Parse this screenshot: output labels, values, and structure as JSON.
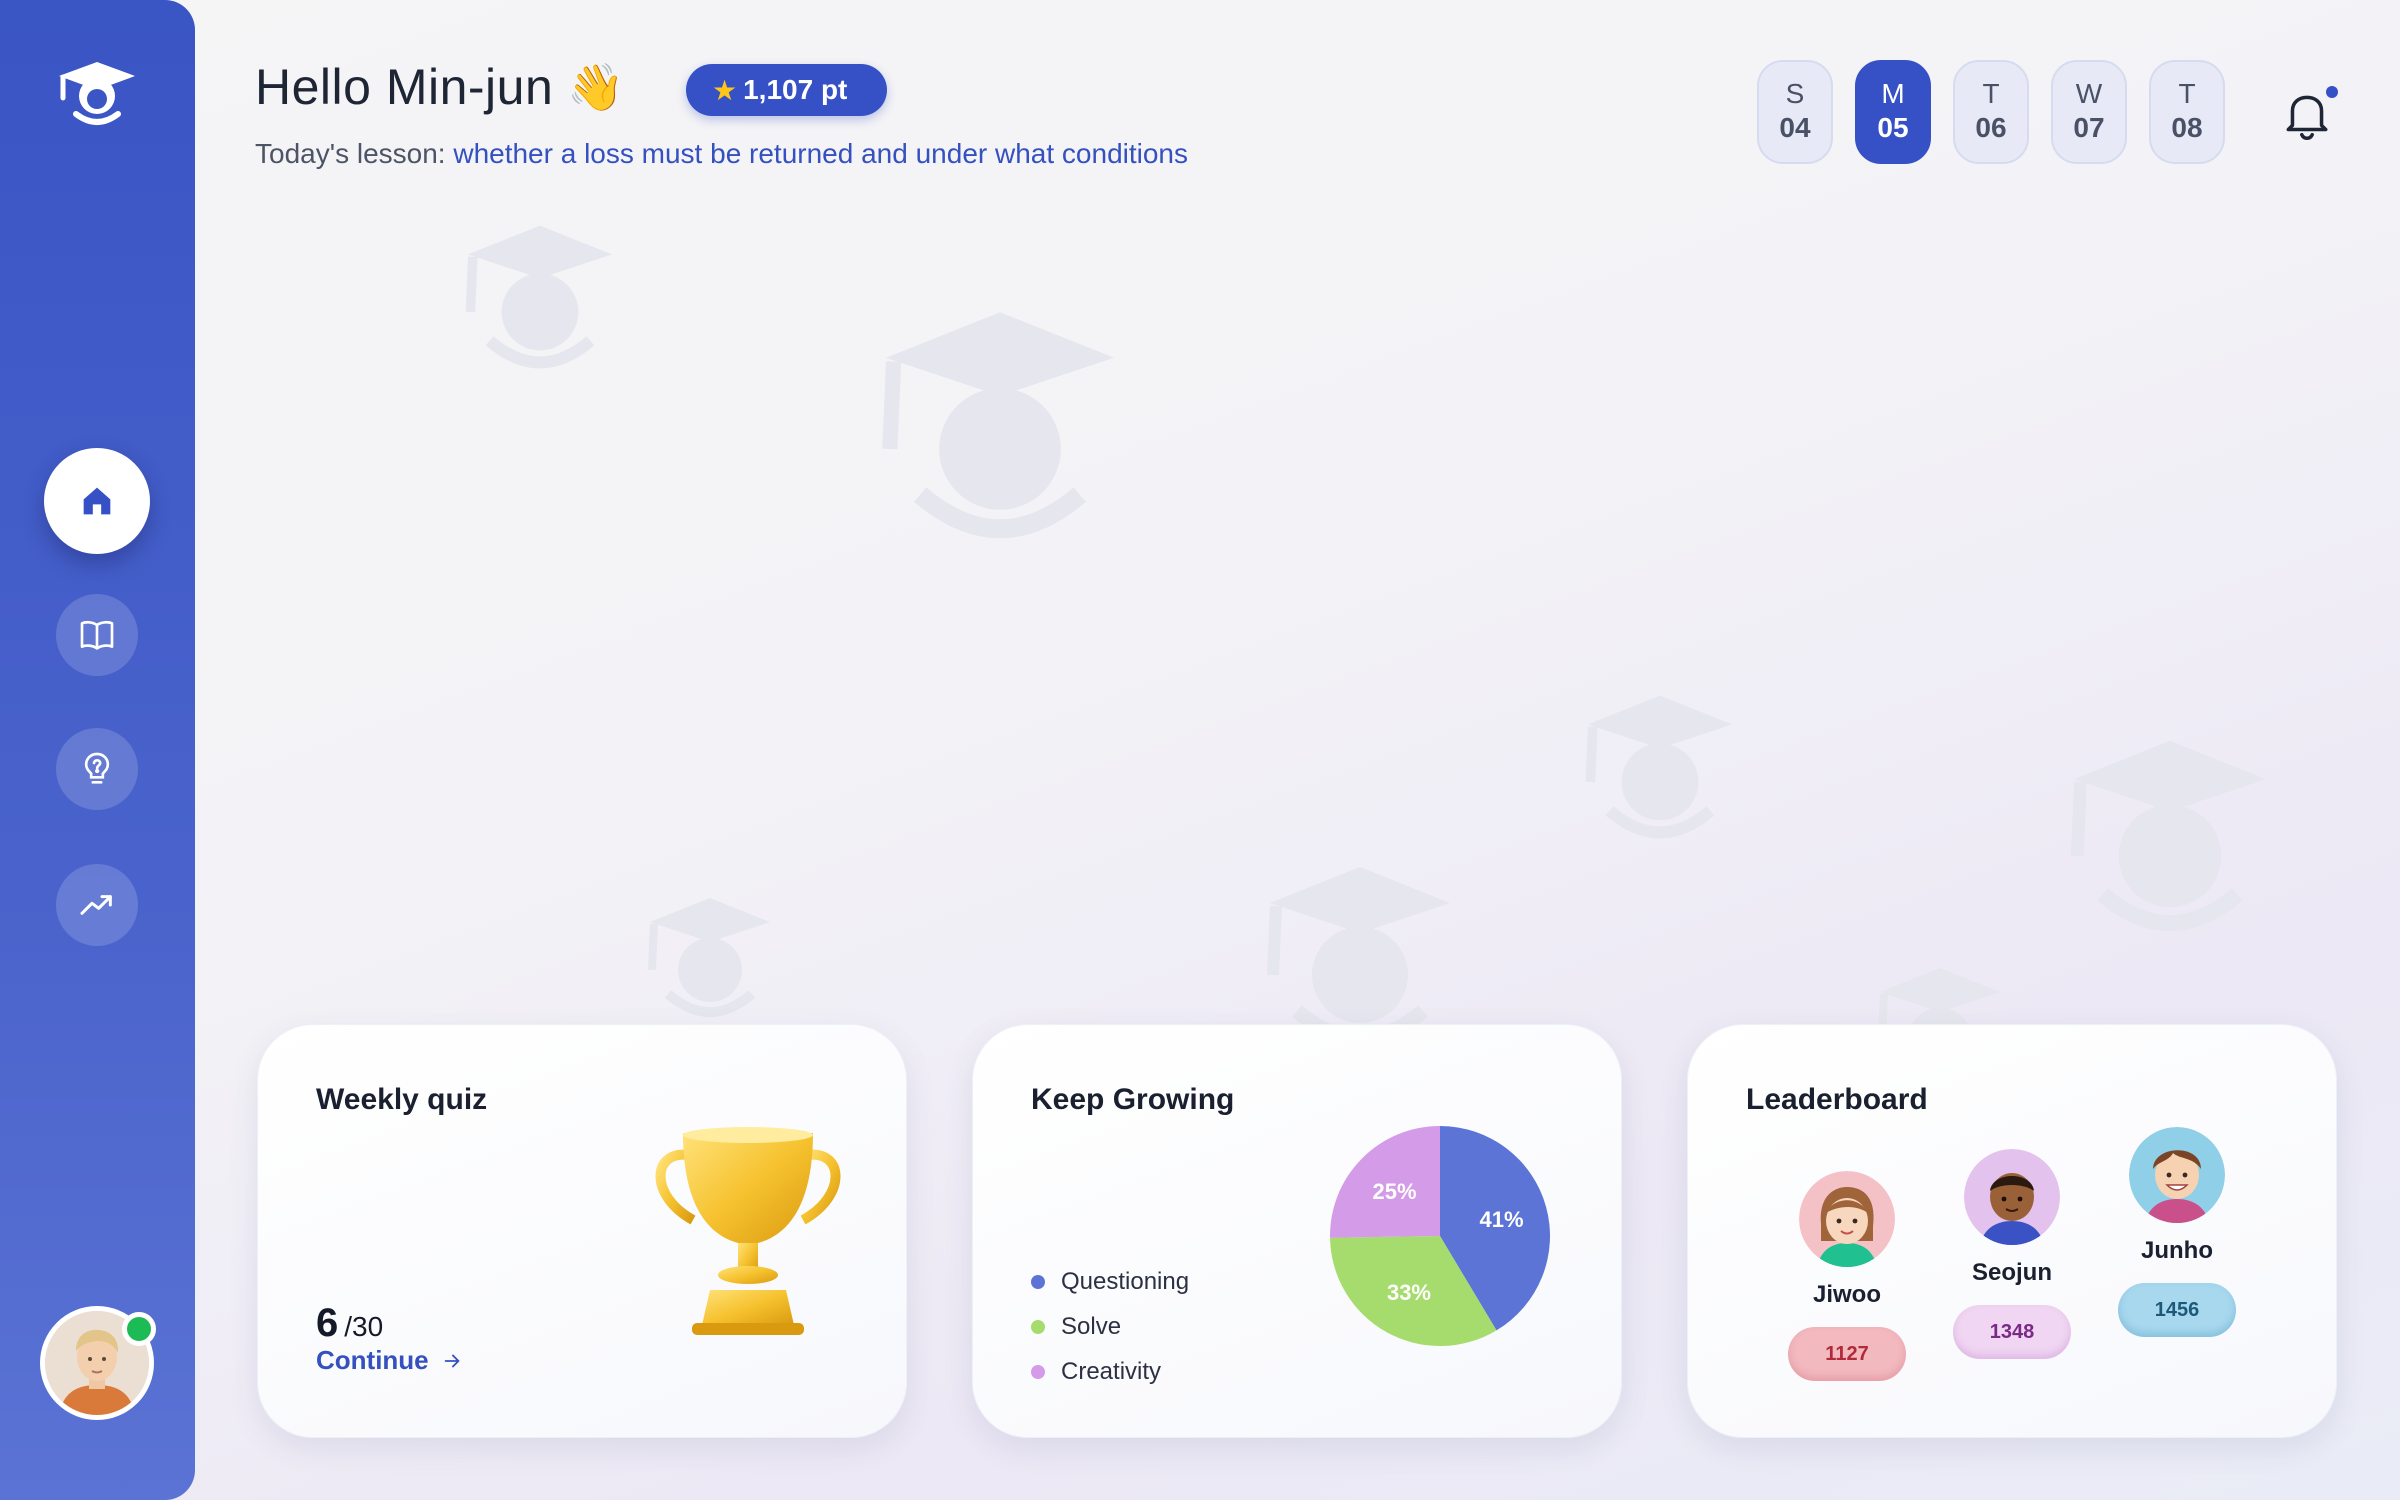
{
  "header": {
    "greeting": "Hello Min-jun",
    "wave_emoji": "👋",
    "points": "1,107 pt",
    "lesson_label": "Today's lesson:",
    "lesson_topic": "whether a loss must be returned and under what conditions"
  },
  "days": [
    {
      "name": "S",
      "date": "04",
      "active": false
    },
    {
      "name": "M",
      "date": "05",
      "active": true
    },
    {
      "name": "T",
      "date": "06",
      "active": false
    },
    {
      "name": "W",
      "date": "07",
      "active": false
    },
    {
      "name": "T",
      "date": "08",
      "active": false
    }
  ],
  "sidebar": {
    "items": [
      {
        "icon": "home-icon",
        "active": true
      },
      {
        "icon": "book-icon",
        "active": false
      },
      {
        "icon": "lightbulb-question-icon",
        "active": false
      },
      {
        "icon": "trending-up-icon",
        "active": false
      }
    ],
    "user_status": "online"
  },
  "weekly_quiz": {
    "title": "Weekly quiz",
    "score": "6",
    "total": "/30",
    "action": "Continue"
  },
  "keep_growing": {
    "title": "Keep Growing",
    "legend": [
      {
        "label": "Questioning",
        "color": "#5b74d6"
      },
      {
        "label": "Solve",
        "color": "#a6dc6e"
      },
      {
        "label": "Creativity",
        "color": "#d39be8"
      }
    ]
  },
  "chart_data": {
    "type": "pie",
    "slices": [
      {
        "label": "Questioning",
        "value": 41,
        "text": "41%",
        "color": "#5b74d6"
      },
      {
        "label": "Solve",
        "value": 33,
        "text": "33%",
        "color": "#a6dc6e"
      },
      {
        "label": "Creativity",
        "value": 25,
        "text": "25%",
        "color": "#d39be8"
      }
    ],
    "legend_position": "left"
  },
  "leaderboard": {
    "title": "Leaderboard",
    "entries": [
      {
        "name": "Jiwoo",
        "score": "1127",
        "color": "#f2b9bf",
        "text_color": "#b02a3a"
      },
      {
        "name": "Seojun",
        "score": "1348",
        "color": "#f0d6f2",
        "text_color": "#7a2a86"
      },
      {
        "name": "Junho",
        "score": "1456",
        "color": "#a7d8ee",
        "text_color": "#1d5a78"
      }
    ]
  },
  "colors": {
    "primary": "#3651c6",
    "online": "#1dbb55",
    "star": "#ffc61a"
  }
}
